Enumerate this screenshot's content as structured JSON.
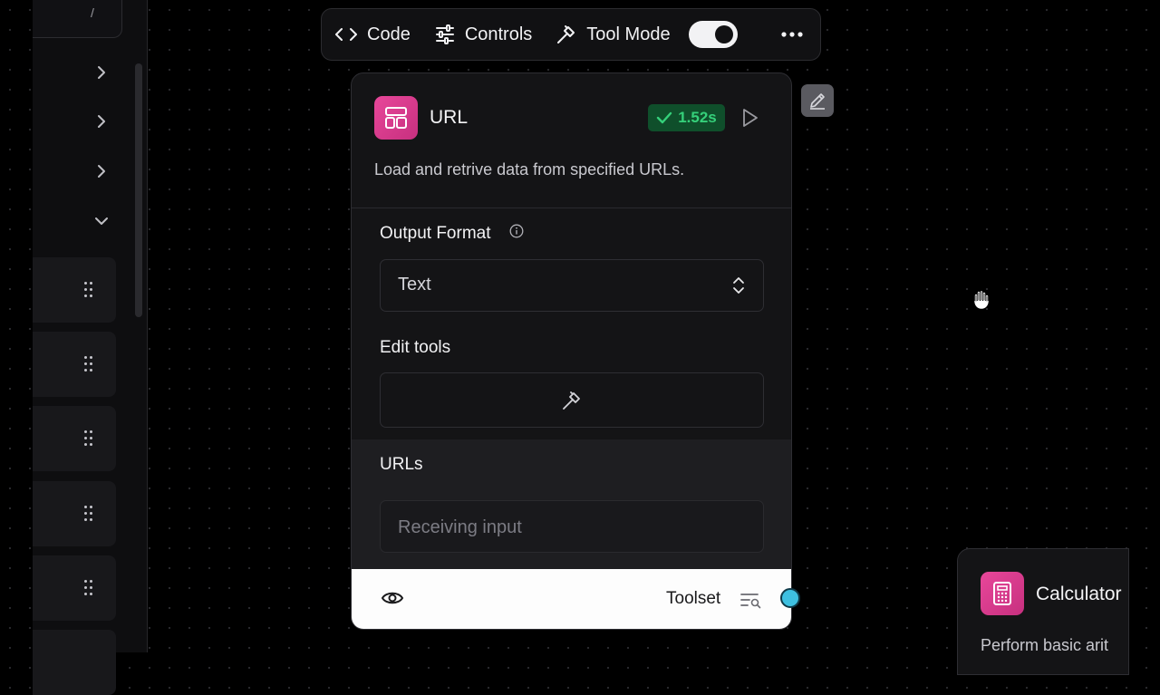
{
  "sidebar": {
    "search_shortcut": "/"
  },
  "toolbar": {
    "code_label": "Code",
    "controls_label": "Controls",
    "tool_mode_label": "Tool Mode",
    "tool_mode_on": true
  },
  "node": {
    "title": "URL",
    "status_time": "1.52s",
    "status_color": "#35d07a",
    "icon_color": "#e8479a",
    "description": "Load and retrive data from specified URLs.",
    "output_format": {
      "label": "Output Format",
      "value": "Text"
    },
    "edit_tools": {
      "label": "Edit tools"
    },
    "urls": {
      "label": "URLs",
      "placeholder": "Receiving input"
    },
    "footer": {
      "toolset_label": "Toolset"
    }
  },
  "calculator_node": {
    "title": "Calculator",
    "description": "Perform basic arit"
  }
}
